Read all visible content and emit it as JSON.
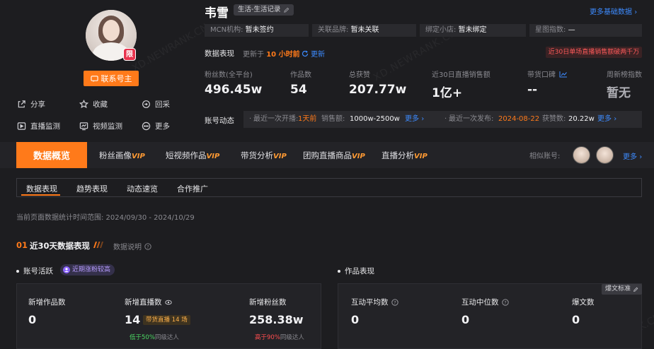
{
  "profile": {
    "name": "韦雪",
    "category": "生活-生活记录",
    "shop_badge": "限",
    "contact_label": "联系号主",
    "more_basic": "更多基础数据",
    "info": [
      {
        "label": "MCN机构:",
        "value": "暂未签约"
      },
      {
        "label": "关联品牌:",
        "value": "暂未关联"
      },
      {
        "label": "绑定小店:",
        "value": "暂未绑定"
      },
      {
        "label": "星图指数:",
        "value": "—"
      }
    ],
    "actions": [
      {
        "label": "分享",
        "icon": "share-icon"
      },
      {
        "label": "收藏",
        "icon": "star-icon"
      },
      {
        "label": "回采",
        "icon": "refresh-icon"
      },
      {
        "label": "直播监测",
        "icon": "live-icon"
      },
      {
        "label": "视频监测",
        "icon": "chart-icon"
      },
      {
        "label": "更多",
        "icon": "more-icon"
      }
    ]
  },
  "performance": {
    "label": "数据表现",
    "updated_prefix": "更新于",
    "updated_value": "10 小时前",
    "update_link": "更新",
    "alert": "近30日单场直播销售额破两千万",
    "stats": [
      {
        "label": "粉丝数(全平台)",
        "value": "496.45w"
      },
      {
        "label": "作品数",
        "value": "54"
      },
      {
        "label": "总获赞",
        "value": "207.77w"
      },
      {
        "label": "近30日直播销售额",
        "value": "1亿+"
      },
      {
        "label": "带货口碑",
        "value": "--"
      },
      {
        "label": "周新榜指数",
        "value": "暂无"
      }
    ]
  },
  "account_dynamic": {
    "label": "账号动态",
    "live_prefix": "最近一次开播:",
    "live_value": "1天前",
    "sales_prefix": "销售额:",
    "sales_value": "1000w-2500w",
    "more1": "更多",
    "publish_prefix": "最近一次发布:",
    "publish_value": "2024-08-22",
    "likes_prefix": "获赞数:",
    "likes_value": "20.22w",
    "more2": "更多"
  },
  "tabs": {
    "active": "数据概览",
    "items": [
      {
        "label": "粉丝画像",
        "vip": "VIP"
      },
      {
        "label": "短视频作品",
        "vip": "VIP"
      },
      {
        "label": "带货分析",
        "vip": "VIP"
      },
      {
        "label": "团购直播商品",
        "vip": "VIP"
      },
      {
        "label": "直播分析",
        "vip": "VIP"
      }
    ],
    "similar_label": "相似账号:",
    "similar_more": "更多"
  },
  "subtabs": [
    "数据表现",
    "趋势表现",
    "动态速览",
    "合作推广"
  ],
  "range": "当前页面数据统计时间范围: 2024/09/30 - 2024/10/29",
  "section": {
    "num": "01",
    "title": "近30天数据表现",
    "note": "数据说明"
  },
  "account_active": {
    "heading": "账号活跃",
    "badge": "近期涨粉较高",
    "cards": [
      {
        "label": "新增作品数",
        "value": "0"
      },
      {
        "label": "新增直播数",
        "value": "14",
        "tag": "带货直播 14 场",
        "sub_hi": "低于50%",
        "sub_rest": "同级达人"
      },
      {
        "label": "新增粉丝数",
        "value": "258.38w",
        "sub_hi": "高于90%",
        "sub_rest": "同级达人"
      }
    ]
  },
  "works": {
    "heading": "作品表现",
    "standard": "爆文标准",
    "cards": [
      {
        "label": "互动平均数",
        "value": "0"
      },
      {
        "label": "互动中位数",
        "value": "0"
      },
      {
        "label": "爆文数",
        "value": "0"
      }
    ]
  },
  "watermark": "XD.NEWRANK.CN",
  "colors": {
    "accent": "#ff7a1a",
    "link": "#3d8bff",
    "bg": "#1d1d20",
    "green": "#4cd964",
    "red": "#ff4d4f"
  }
}
